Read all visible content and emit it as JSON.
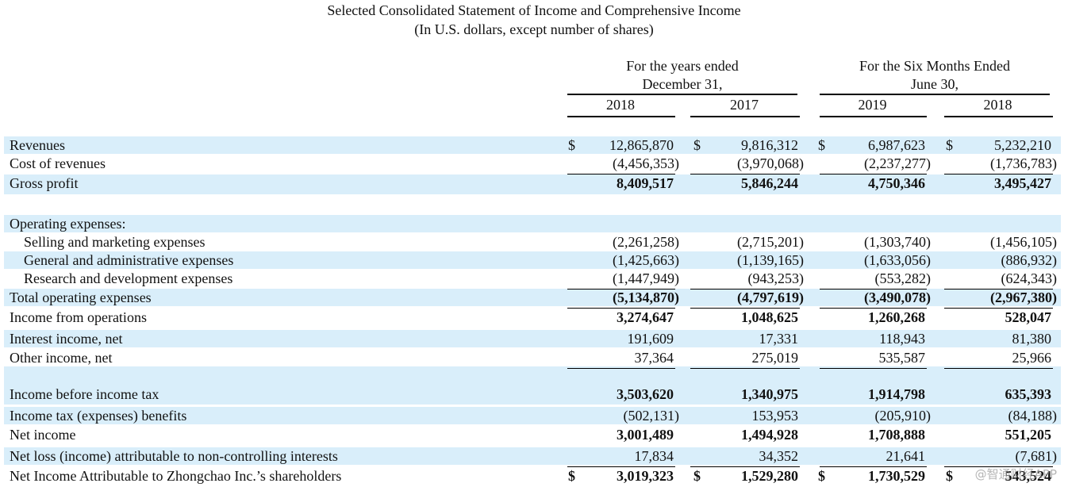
{
  "header": {
    "title": "Selected Consolidated Statement of Income and Comprehensive Income",
    "subtitle": "(In U.S. dollars, except number of shares)",
    "group_years_line1": "For the years ended",
    "group_years_line2": "December 31,",
    "group_six_line1": "For the Six Months Ended",
    "group_six_line2": "June 30,",
    "columns": [
      "2018",
      "2017",
      "2019",
      "2018"
    ]
  },
  "currency_symbol": "$",
  "rows": [
    {
      "label": "Revenues",
      "values": [
        "12,865,870",
        "9,816,312",
        "6,987,623",
        "5,232,210"
      ],
      "dollar": true
    },
    {
      "label": "Cost of revenues",
      "values": [
        "(4,456,353)",
        "(3,970,068)",
        "(2,237,277)",
        "(1,736,783)"
      ]
    },
    {
      "label": "Gross profit",
      "values": [
        "8,409,517",
        "5,846,244",
        "4,750,346",
        "3,495,427"
      ],
      "bold": true
    },
    {
      "label": "Operating expenses:",
      "values": []
    },
    {
      "label": "Selling and marketing expenses",
      "values": [
        "(2,261,258)",
        "(2,715,201)",
        "(1,303,740)",
        "(1,456,105)"
      ],
      "indent": true
    },
    {
      "label": "General and administrative expenses",
      "values": [
        "(1,425,663)",
        "(1,139,165)",
        "(1,633,056)",
        "(886,932)"
      ],
      "indent": true
    },
    {
      "label": "Research and development expenses",
      "values": [
        "(1,447,949)",
        "(943,253)",
        "(553,282)",
        "(624,343)"
      ],
      "indent": true
    },
    {
      "label": "Total operating expenses",
      "values": [
        "(5,134,870)",
        "(4,797,619)",
        "(3,490,078)",
        "(2,967,380)"
      ],
      "bold": true
    },
    {
      "label": "Income from operations",
      "values": [
        "3,274,647",
        "1,048,625",
        "1,260,268",
        "528,047"
      ],
      "bold": true
    },
    {
      "label": "Interest income, net",
      "values": [
        "191,609",
        "17,331",
        "118,943",
        "81,380"
      ]
    },
    {
      "label": "Other income, net",
      "values": [
        "37,364",
        "275,019",
        "535,587",
        "25,966"
      ]
    },
    {
      "label": "Income before income tax",
      "values": [
        "3,503,620",
        "1,340,975",
        "1,914,798",
        "635,393"
      ],
      "bold": true
    },
    {
      "label": "Income tax (expenses) benefits",
      "values": [
        "(502,131)",
        "153,953",
        "(205,910)",
        "(84,188)"
      ]
    },
    {
      "label": "Net income",
      "values": [
        "3,001,489",
        "1,494,928",
        "1,708,888",
        "551,205"
      ],
      "bold": true
    },
    {
      "label": "Net loss (income)  attributable to non-controlling interests",
      "values": [
        "17,834",
        "34,352",
        "21,641",
        "(7,681)"
      ]
    },
    {
      "label": "Net Income Attributable to Zhongchao Inc.’s shareholders",
      "values": [
        "3,019,323",
        "1,529,280",
        "1,730,529",
        "543,524"
      ],
      "bold": true,
      "dollar": true
    }
  ],
  "watermark": "@智通财经APP"
}
